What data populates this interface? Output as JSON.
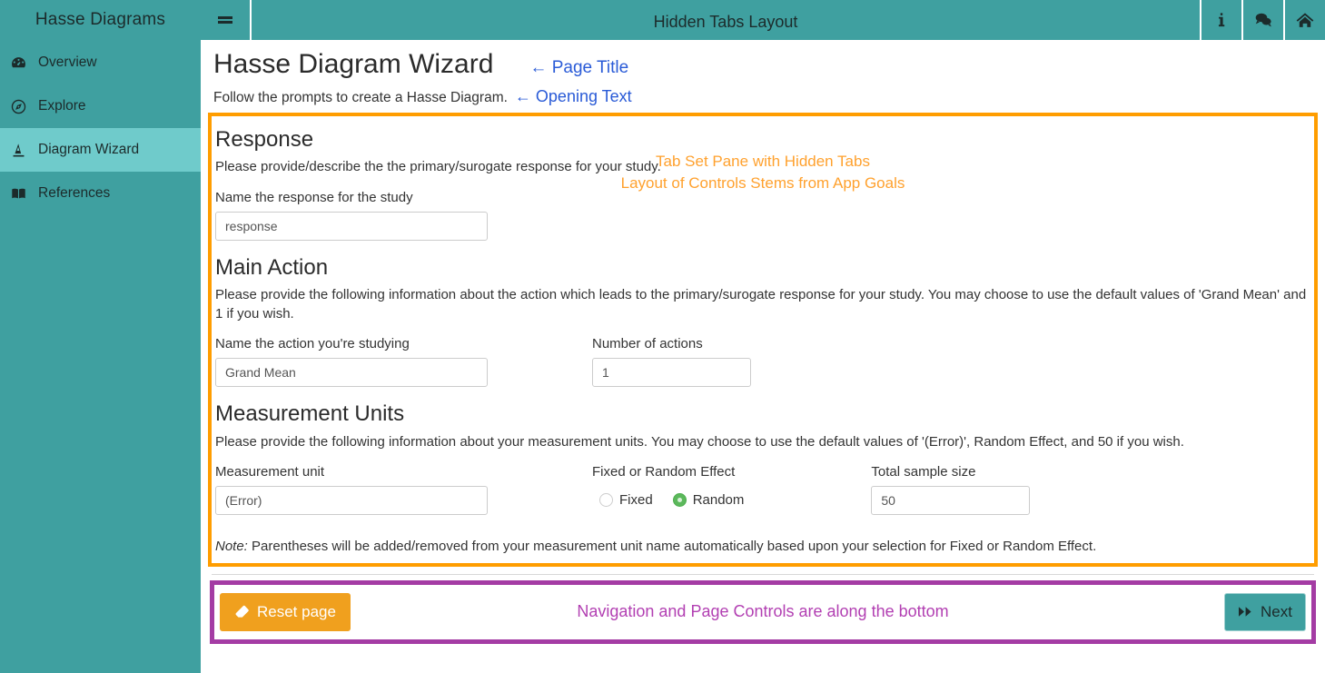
{
  "sidebar": {
    "brand": "Hasse Diagrams",
    "items": [
      {
        "label": "Overview",
        "icon": "tachometer-icon",
        "active": false
      },
      {
        "label": "Explore",
        "icon": "compass-icon",
        "active": false
      },
      {
        "label": "Diagram Wizard",
        "icon": "magic-wand-icon",
        "active": true
      },
      {
        "label": "References",
        "icon": "book-icon",
        "active": false
      }
    ]
  },
  "topbar": {
    "menu_toggle": "hamburger-icon",
    "title": "Hidden Tabs Layout",
    "icons": [
      {
        "name": "info-icon",
        "glyph": "i"
      },
      {
        "name": "comments-icon",
        "glyph": "comments"
      },
      {
        "name": "home-icon",
        "glyph": "home"
      }
    ]
  },
  "page": {
    "title": "Hasse Diagram Wizard",
    "title_annotation": "← Page Title",
    "opening_text": "Follow the prompts to create a Hasse Diagram.",
    "opening_annotation": "← Opening Text"
  },
  "tabpane": {
    "annotation_line1": "Tab Set Pane with Hidden Tabs",
    "annotation_line2": "Layout of Controls Stems from App Goals",
    "sections": [
      {
        "heading": "Response",
        "description": "Please provide/describe the the primary/surogate response for your study.",
        "fields": [
          {
            "label": "Name the response for the study",
            "type": "text",
            "value": "response",
            "placeholder": "response"
          }
        ]
      },
      {
        "heading": "Main Action",
        "description": "Please provide the following information about the action which leads to the primary/surogate response for your study. You may choose to use the default values of 'Grand Mean' and 1 if you wish.",
        "fields": [
          {
            "label": "Name the action you're studying",
            "type": "text",
            "value": "Grand Mean",
            "placeholder": "Grand Mean"
          },
          {
            "label": "Number of actions",
            "type": "number",
            "value": "1",
            "placeholder": "1"
          }
        ]
      },
      {
        "heading": "Measurement Units",
        "description": "Please provide the following information about your measurement units. You may choose to use the default values of '(Error)', Random Effect, and 50 if you wish.",
        "fields": [
          {
            "label": "Measurement unit",
            "type": "text",
            "value": "(Error)",
            "placeholder": "(Error)"
          },
          {
            "label": "Fixed or Random Effect",
            "type": "radio",
            "options": [
              {
                "label": "Fixed",
                "selected": false
              },
              {
                "label": "Random",
                "selected": true
              }
            ]
          },
          {
            "label": "Total sample size",
            "type": "number",
            "value": "50",
            "placeholder": "50"
          }
        ],
        "note_prefix": "Note:",
        "note_text": " Parentheses will be added/removed from your measurement unit name automatically based upon your selection for Fixed or Random Effect."
      }
    ]
  },
  "navbar": {
    "reset_label": "Reset page",
    "reset_icon": "eraser-icon",
    "next_label": "Next",
    "next_icon": "fast-forward-icon",
    "annotation": "Navigation and Page Controls are along the bottom"
  },
  "colors": {
    "teal": "#3fa0a0",
    "teal_active": "#6fcbcb",
    "orange_annotation": "#ffa12e",
    "orange_border": "#ff9d00",
    "purple_annotation": "#b23fb2",
    "purple_border": "#a43ca4",
    "blue_annotation": "#2a5bd7",
    "reset_orange": "#f0a01e",
    "radio_green": "#5cb85c"
  }
}
